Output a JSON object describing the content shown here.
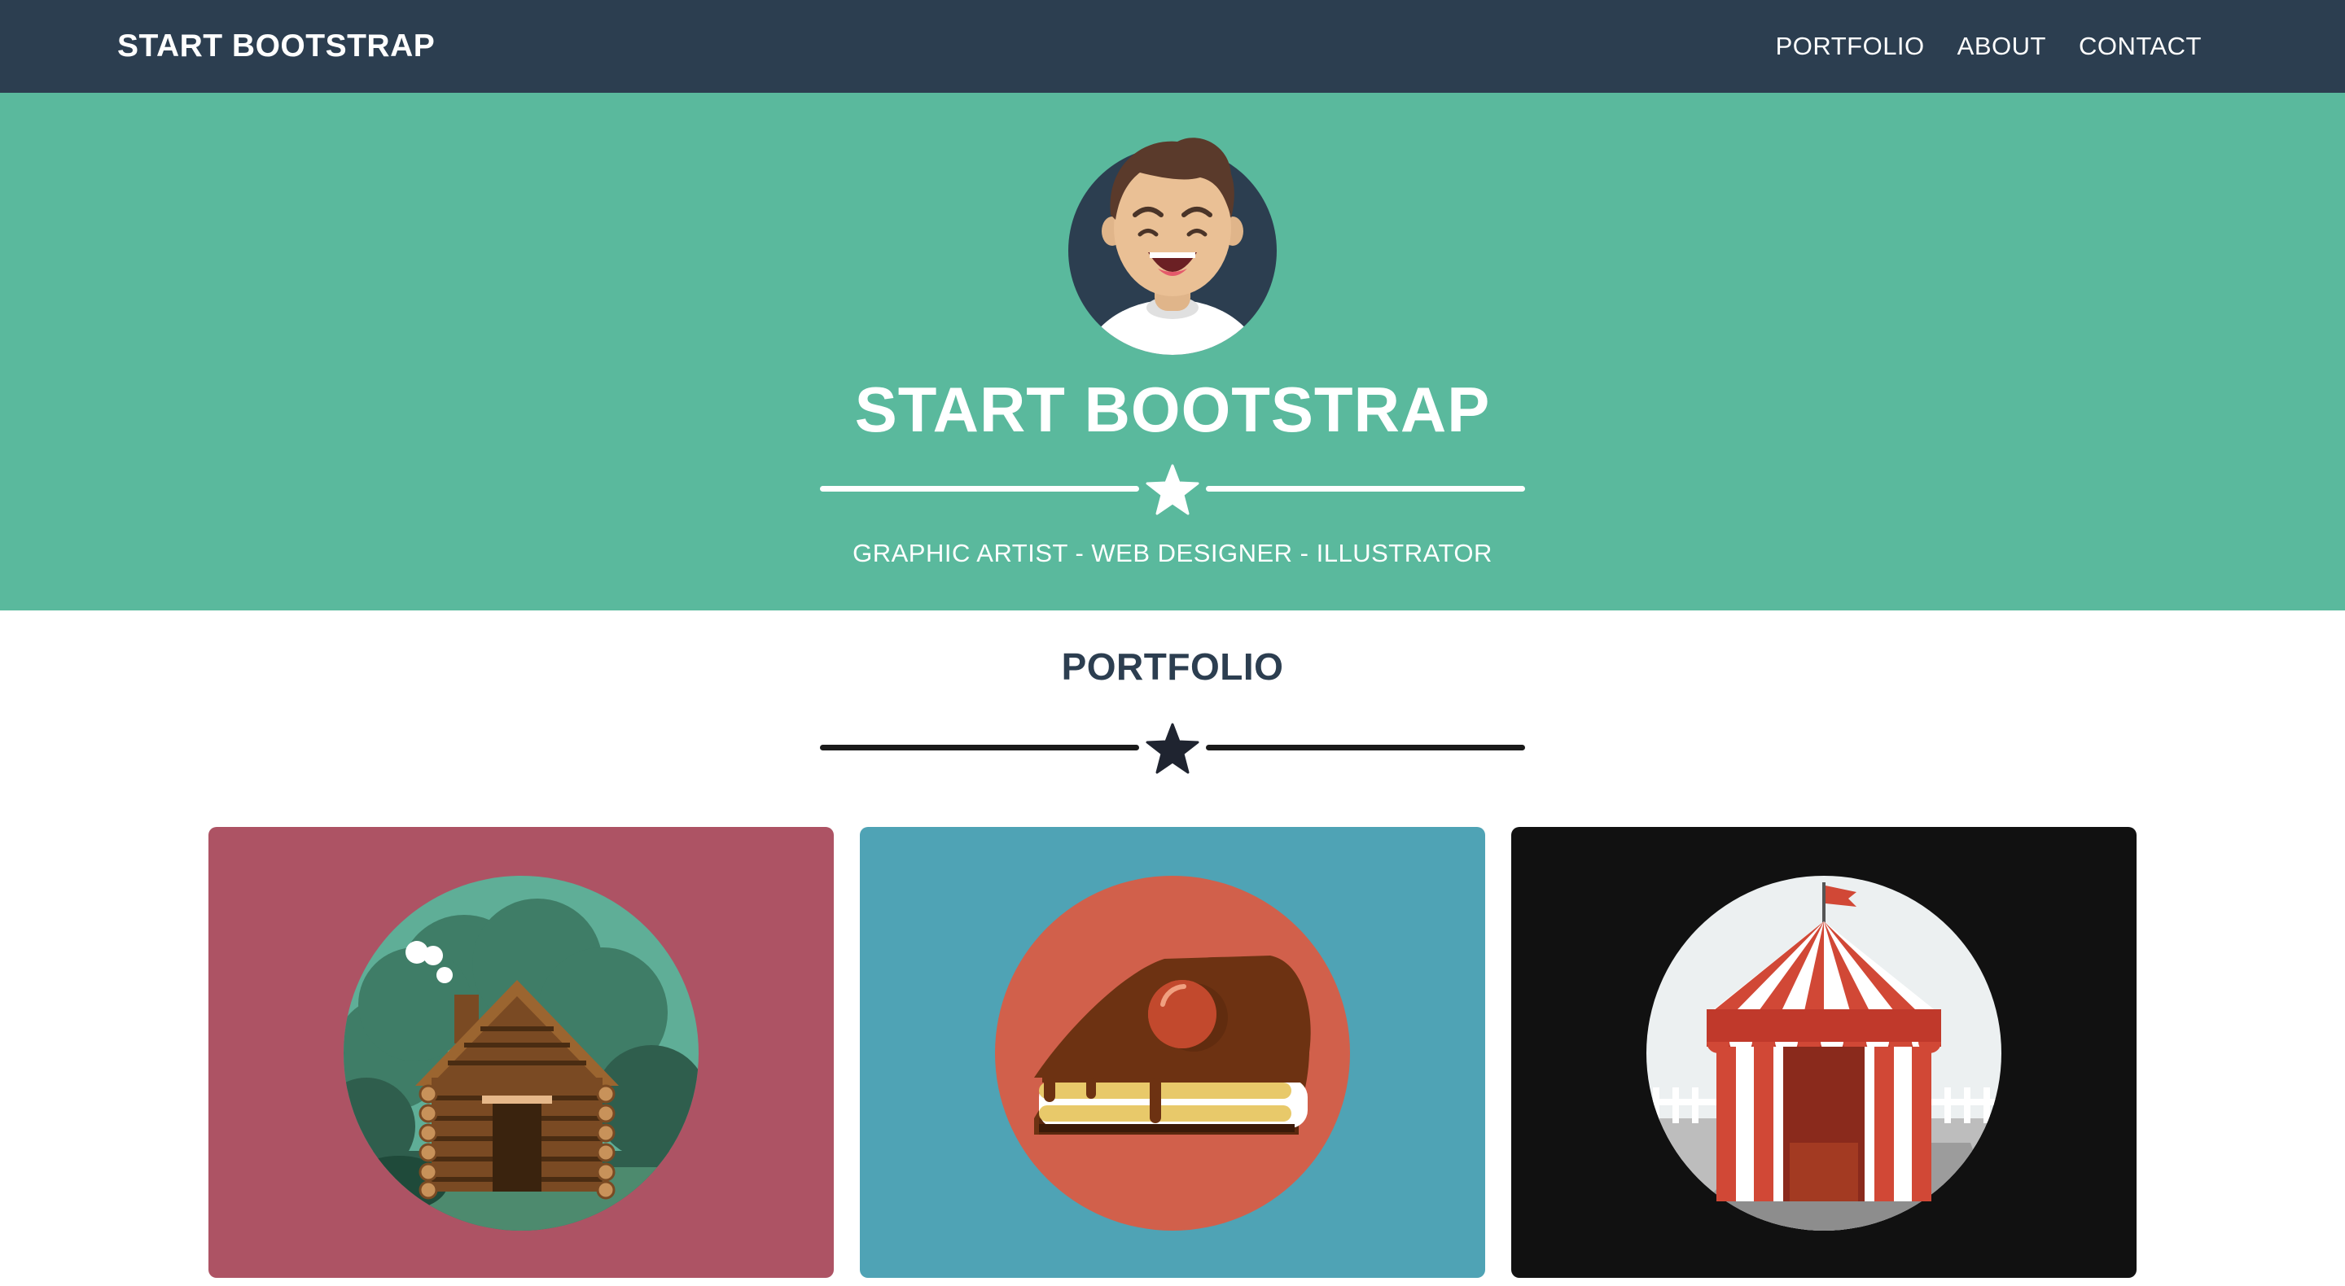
{
  "navbar": {
    "brand": "START BOOTSTRAP",
    "links": [
      "PORTFOLIO",
      "ABOUT",
      "CONTACT"
    ]
  },
  "masthead": {
    "title": "START BOOTSTRAP",
    "subtitle": "GRAPHIC ARTIST - WEB DESIGNER - ILLUSTRATOR",
    "divider_icon": "star-icon"
  },
  "portfolio": {
    "heading": "PORTFOLIO",
    "divider_icon": "star-icon",
    "items": [
      {
        "icon": "cabin-icon",
        "background": "#ad5364"
      },
      {
        "icon": "cake-icon",
        "background": "#4fa3b5"
      },
      {
        "icon": "circus-tent-icon",
        "background": "#111111"
      }
    ]
  },
  "colors": {
    "navbar": "#2c3e50",
    "masthead": "#5ab99d",
    "heading_text": "#2c3e50"
  }
}
